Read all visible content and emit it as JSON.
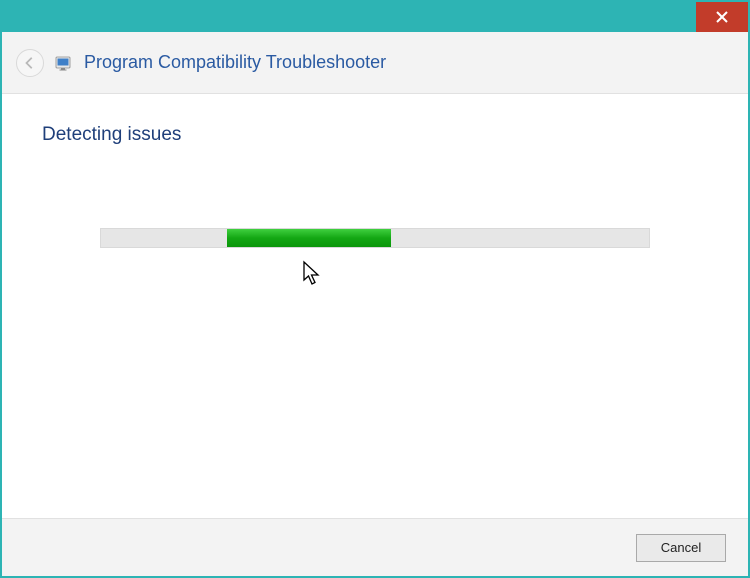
{
  "window": {
    "title": "Program Compatibility Troubleshooter"
  },
  "content": {
    "status_heading": "Detecting issues"
  },
  "progress": {
    "indeterminate_left_pct": 23,
    "indeterminate_width_pct": 30
  },
  "footer": {
    "cancel_label": "Cancel"
  },
  "icons": {
    "back": "back-arrow-icon",
    "app": "troubleshooter-app-icon",
    "close": "close-icon"
  }
}
